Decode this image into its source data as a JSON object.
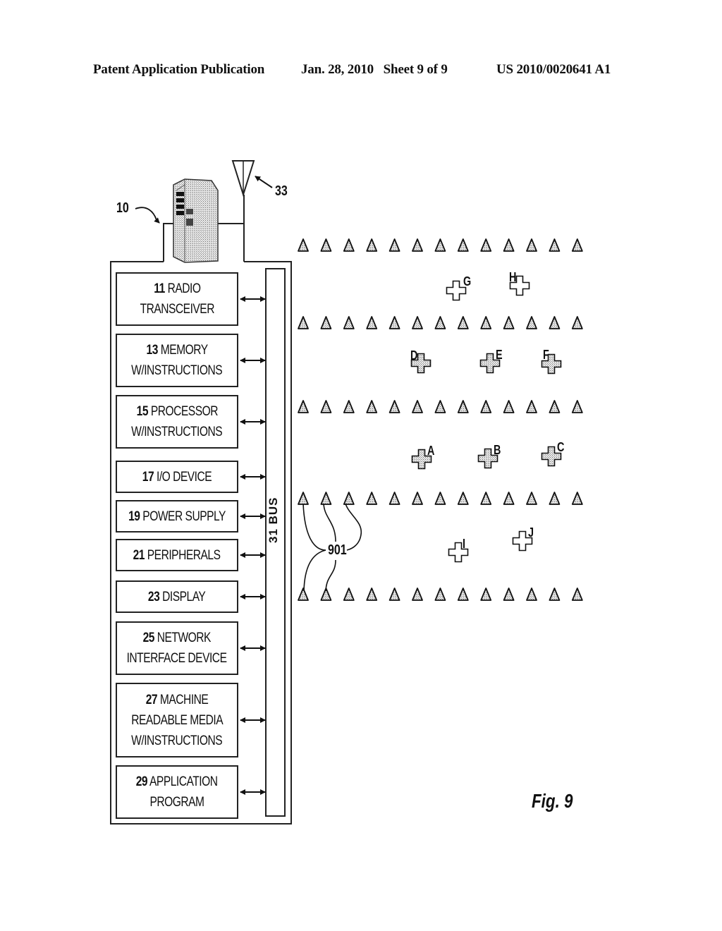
{
  "header": {
    "publication": "Patent Application Publication",
    "date_sheet": "Jan. 28, 2010   Sheet 9 of 9",
    "patent_number": "US 2010/0020641 A1"
  },
  "figure_label": "Fig. 9",
  "device": {
    "ref_label": "10",
    "antenna_label": "33",
    "bus_label": "31 BUS",
    "components": [
      {
        "num": "11",
        "lines": [
          "RADIO",
          "TRANSCEIVER"
        ]
      },
      {
        "num": "13",
        "lines": [
          "MEMORY",
          "W/INSTRUCTIONS"
        ]
      },
      {
        "num": "15",
        "lines": [
          "PROCESSOR",
          "W/INSTRUCTIONS"
        ]
      },
      {
        "num": "17",
        "lines": [
          "I/O DEVICE"
        ]
      },
      {
        "num": "19",
        "lines": [
          "POWER SUPPLY"
        ]
      },
      {
        "num": "21",
        "lines": [
          "PERIPHERALS"
        ]
      },
      {
        "num": "23",
        "lines": [
          "DISPLAY"
        ]
      },
      {
        "num": "25",
        "lines": [
          "NETWORK",
          "INTERFACE DEVICE"
        ]
      },
      {
        "num": "27",
        "lines": [
          "MACHINE",
          "READABLE MEDIA",
          "W/INSTRUCTIONS"
        ]
      },
      {
        "num": "29",
        "lines": [
          "APPLICATION",
          "PROGRAM"
        ]
      }
    ]
  },
  "sensor_grid": {
    "label": "901",
    "rows": 5,
    "per_row": 13
  },
  "markers": [
    {
      "id": "G",
      "style": "outline"
    },
    {
      "id": "H",
      "style": "outline"
    },
    {
      "id": "D",
      "style": "filled"
    },
    {
      "id": "E",
      "style": "filled"
    },
    {
      "id": "F",
      "style": "filled"
    },
    {
      "id": "A",
      "style": "filled"
    },
    {
      "id": "B",
      "style": "filled"
    },
    {
      "id": "C",
      "style": "filled"
    },
    {
      "id": "I",
      "style": "outline"
    },
    {
      "id": "J",
      "style": "outline"
    }
  ]
}
